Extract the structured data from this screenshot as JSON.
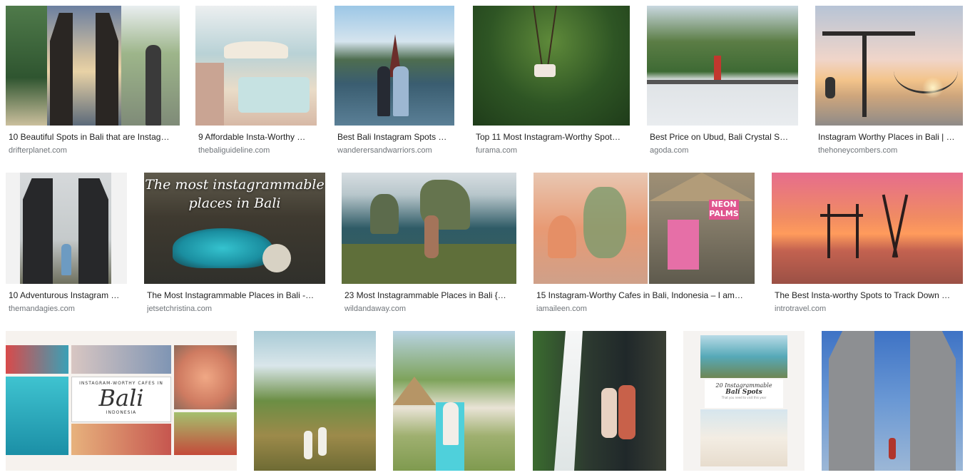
{
  "results": [
    {
      "caption": "10 Beautiful Spots in Bali that are Instag…",
      "source": "drifterplanet.com",
      "icon": "image-bali-temple-gate"
    },
    {
      "caption": "9 Affordable Insta-Worthy …",
      "source": "thebaliguideline.com",
      "icon": "image-beach-club"
    },
    {
      "caption": "Best Bali Instagram Spots …",
      "source": "wanderersandwarriors.com",
      "icon": "image-water-temple"
    },
    {
      "caption": "Top 11 Most Instagram-Worthy Spot…",
      "source": "furama.com",
      "icon": "image-jungle-swing"
    },
    {
      "caption": "Best Price on Ubud, Bali Crystal S…",
      "source": "agoda.com",
      "icon": "image-infinity-pool"
    },
    {
      "caption": "Instagram Worthy Places in Bali | …",
      "source": "thehoneycombers.com",
      "icon": "image-sunset-swing"
    },
    {
      "caption": "10 Adventurous Instagram …",
      "source": "themandagies.com",
      "icon": "image-temple-gate-fog"
    },
    {
      "caption": "The Most Instagrammable Places in Bali -…",
      "source": "jetsetchristina.com",
      "icon": "image-broken-beach",
      "overlay": "The most instagrammable places in Bali"
    },
    {
      "caption": "23 Most Instagrammable Places in Bali {…",
      "source": "wildandaway.com",
      "icon": "image-cliff-coast"
    },
    {
      "caption": "15 Instagram-Worthy Cafes in Bali, Indonesia – I am…",
      "source": "iamaileen.com",
      "icon": "image-cafe-collage",
      "overlay": "NEON PALMS"
    },
    {
      "caption": "The Best Insta-worthy Spots to Track Down …",
      "source": "introtravel.com",
      "icon": "image-sea-swing-sunset"
    },
    {
      "caption": "",
      "source": "",
      "icon": "image-cafe-collage-bali",
      "overlay_top": "INSTAGRAM-WORTHY CAFES IN",
      "overlay": "Bali",
      "overlay_bottom": "INDONESIA"
    },
    {
      "caption": "",
      "source": "",
      "icon": "image-rice-terrace"
    },
    {
      "caption": "",
      "source": "",
      "icon": "image-villa-pool"
    },
    {
      "caption": "",
      "source": "",
      "icon": "image-waterfall-couple"
    },
    {
      "caption": "",
      "source": "",
      "icon": "image-bali-spots-poster",
      "overlay_top": "20 Instagrammable",
      "overlay": "Bali Spots",
      "overlay_bottom": "That you need to visit this year"
    },
    {
      "caption": "",
      "source": "",
      "icon": "image-gates-of-heaven"
    }
  ]
}
